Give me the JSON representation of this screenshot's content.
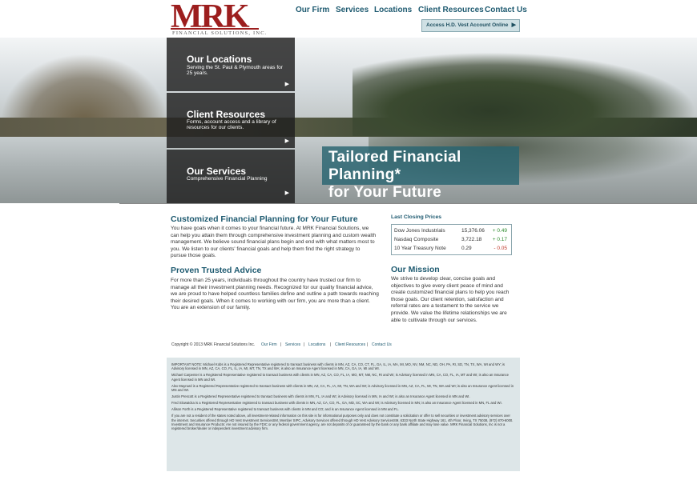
{
  "logo": {
    "mark": "MRK",
    "sub": "FINANCIAL SOLUTIONS, INC."
  },
  "nav": {
    "items": [
      "Our Firm",
      "Services",
      "Locations",
      "Client Resources",
      "Contact Us"
    ]
  },
  "cta": {
    "label": "Access H.D. Vest Account Online",
    "arrow": "▶"
  },
  "panels": [
    {
      "title": "Our Locations",
      "desc": "Serving the St. Paul & Plymouth areas for 25 years."
    },
    {
      "title": "Client Resources",
      "desc": "Forms, account access and a library of resources for our clients."
    },
    {
      "title": "Our Services",
      "desc": "Comprehensive Financial Planning"
    }
  ],
  "panel_arrow": "▶",
  "hero_tag": {
    "line1": "Tailored Financial Planning*",
    "line2": "for Your Future"
  },
  "main": {
    "h1": "Customized Financial Planning for Your Future",
    "p1": "You have goals when it comes to your financial future. At MRK Financial Solutions, we can help you attain them through comprehensive investment planning and custom wealth management. We believe sound financial plans begin and end with what matters most to you. We listen to our clients' financial goals and help them find the right strategy to pursue those goals.",
    "h2": "Proven Trusted Advice",
    "p2": "For more than 25 years, individuals throughout the country have trusted our firm to manage all their investment planning needs. Recognized for our quality financial advice, we are proud to have helped countless families define and outline a path towards reaching their desired goals. When it comes to working with our firm, you are more than a client. You are an extension of our family."
  },
  "prices": {
    "title": "Last Closing Prices",
    "rows": [
      {
        "name": "Dow Jones Industrials",
        "value": "15,376.06",
        "change": "+ 0.49"
      },
      {
        "name": "Nasdaq Composite",
        "value": "3,722.18",
        "change": "+ 0.17"
      },
      {
        "name": "10 Year Treasury Note",
        "value": "0.29",
        "change": "- 0.05"
      }
    ]
  },
  "mission": {
    "title": "Our Mission",
    "text": "We strive to develop clear, concise goals and objectives to give every client peace of mind and create customized financial plans to help you reach those goals. Our client retention, satisfaction and referral rates are a testament to the service we provide. We value the lifetime relationships we are able to cultivate through our services."
  },
  "footer": {
    "copyright": "Copyright © 2013 MRK Financial Solutions Inc.",
    "links": [
      "Our Firm",
      "Services",
      "Locations",
      "Client Resources",
      "Contact Us"
    ],
    "sep": "|"
  },
  "fine": [
    "IMPORTANT NOTE: Michael Kobs is a Registered Representative registered to transact business with clients in MN, AZ, CA, CO, CT, FL, GA, IL, IA, MA, MI, MO, NV, NM, NC, ND, OH, PA, RI, SD, TN, TX, WA, WI and WY; is Advisory licensed in MN, AZ, CA, CO, FL, IL, IA, MI, MT, TN, TX and WA; is also an Insurance Agent licensed in MN, CA, GA, IA, MI and WI.",
    "Michael Carpenter is a Registered Representative registered to transact business with clients in MN, AZ, CA, CO, FL, IA, MO, MT, NM, NC, RI and WI; is Advisory licensed in MN, CA, CO, FL, IA, MT and WI; is also an Insurance Agent licensed in MN and WI.",
    "Alex Maynard is a Registered Representative registered to transact business with clients in MN, AZ, CA, FL, IA, MI, TN, WA and WI; is Advisory licensed in MN, AZ, CA, FL, MI, TN, WA and WI; is also an Insurance Agent licensed in MN and WI.",
    "Justin Prescott is a Registered Representative registered to transact business with clients in MN, FL, IA and WI; is Advisory licensed in MN, IA and WI; is also an Insurance Agent licensed in MN and WI.",
    "Fred Slowatcka is a Registered Representative registered to transact business with clients in MN, AZ, CA, CO, FL, GA, MD, SC, WA and WI; is Advisory licensed in MN; is also an Insurance Agent licensed in MN, FL and WI.",
    "Allison Forth is a Registered Representative registered to transact business with clients in MN and CO; and is an Insurance Agent licensed in MN and FL.",
    "If you are not a resident of the states noted above, all investment-related information on this site is for informational purposes only and does not constitute a solicitation or offer to sell securities or investment advisory services over the internet. Securities offered through HD Vest Investment ServicesSM, Member SIPC, Advisory Services offered through HD Vest Advisory ServicesSM, 6333 North State Highway 161, 4th Floor, Irving, TX 75038, (972) 870-6000. Investment and Insurance Products: Are not insured by the FDIC or any federal government agency, are not deposits of or guaranteed by the bank or any bank affiliate and may lose value. MRK Financial Solutions, Inc is not a registered broker/dealer or independent investment advisory firm."
  ],
  "colors": {
    "brand": "#9c1e1e",
    "accent": "#1e5a70",
    "up": "#2e8b2e",
    "down": "#c0392b"
  }
}
